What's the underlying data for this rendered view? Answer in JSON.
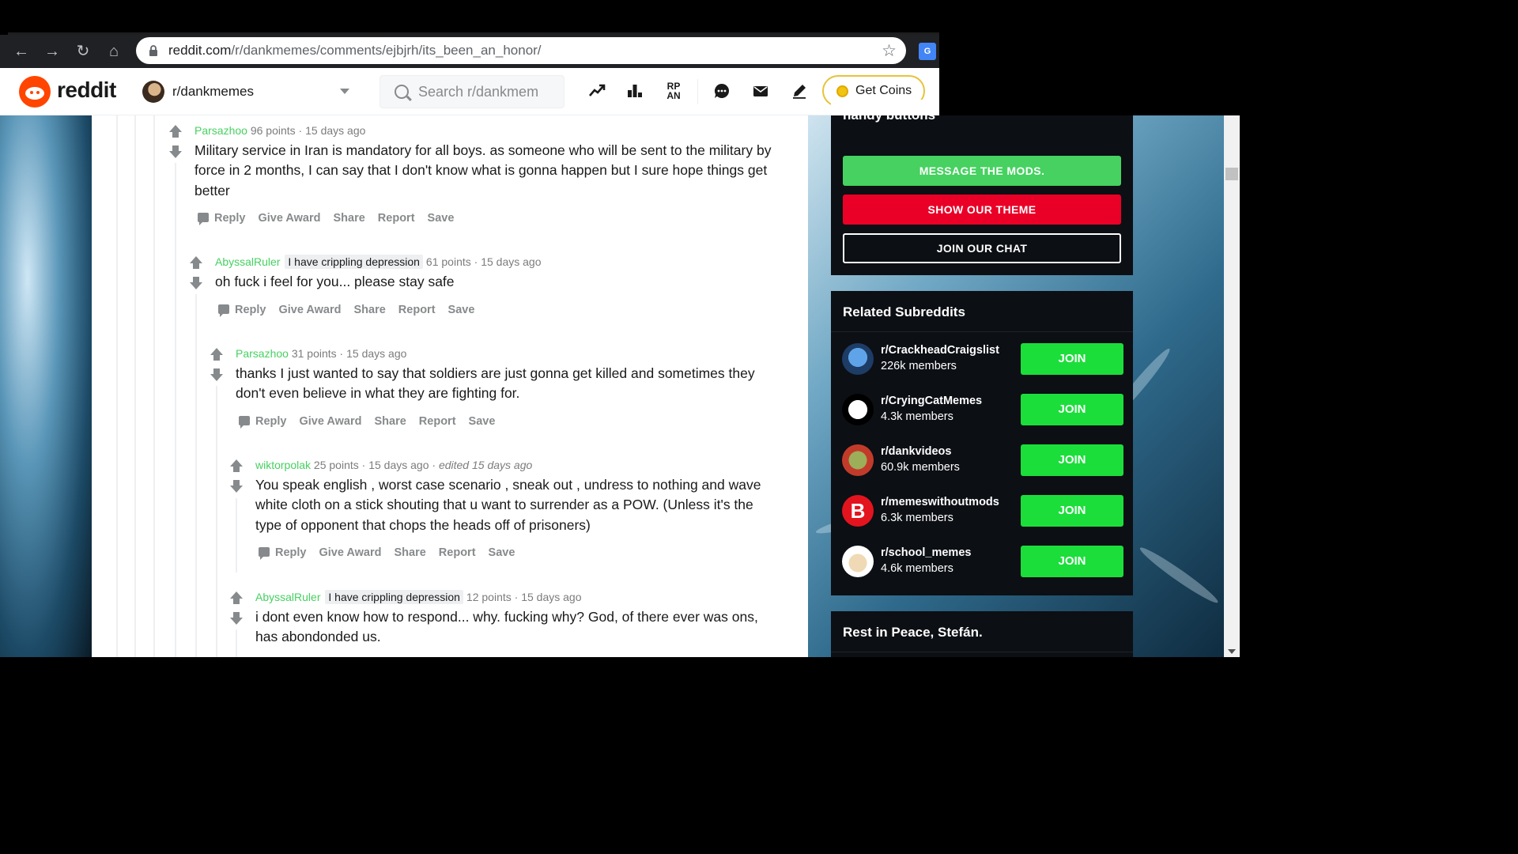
{
  "browser": {
    "url_domain": "reddit.com",
    "url_path": "/r/dankmemes/comments/ejbjrh/its_been_an_honor/",
    "translate_label": "G"
  },
  "header": {
    "logo_text": "reddit",
    "subreddit": "r/dankmemes",
    "search_placeholder": "Search r/dankmem",
    "rpan_label": "RP AN",
    "coins_label": "Get Coins"
  },
  "comments": [
    {
      "author": "Parsazhoo",
      "flair": "",
      "points": "96 points",
      "age": "15 days ago",
      "edited": "",
      "body": "Military service in Iran is mandatory for all boys. as someone who will be sent to the military by force in 2 months, I can say that I don't know what is gonna happen but I sure hope things get better"
    },
    {
      "author": "AbyssalRuler",
      "flair": "I have crippling depression",
      "points": "61 points",
      "age": "15 days ago",
      "edited": "",
      "body": "oh fuck i feel for you... please stay safe"
    },
    {
      "author": "Parsazhoo",
      "flair": "",
      "points": "31 points",
      "age": "15 days ago",
      "edited": "",
      "body": "thanks I just wanted to say that soldiers are just gonna get killed and sometimes they don't even believe in what they are fighting for."
    },
    {
      "author": "wiktorpolak",
      "flair": "",
      "points": "25 points",
      "age": "15 days ago",
      "edited": "edited 15 days ago",
      "body": "You speak english , worst case scenario , sneak out , undress to nothing and wave white cloth on a stick shouting that u want to surrender as a POW. (Unless it's the type of opponent that chops the heads off of prisoners)"
    },
    {
      "author": "AbyssalRuler",
      "flair": "I have crippling depression",
      "points": "12 points",
      "age": "15 days ago",
      "edited": "",
      "body": "i dont even know how to respond... why. fucking why? God, of there ever was ons, has abondonded us."
    }
  ],
  "actions": {
    "reply": "Reply",
    "award": "Give Award",
    "share": "Share",
    "report": "Report",
    "save": "Save"
  },
  "sidebar": {
    "buttons_title": "handy buttons",
    "buttons": [
      {
        "label": "MESSAGE THE MODS.",
        "color": "#46d160"
      },
      {
        "label": "SHOW OUR THEME",
        "color": "#ea0027"
      },
      {
        "label": "JOIN OUR CHAT",
        "color": "#0c0f14"
      }
    ],
    "related_title": "Related Subreddits",
    "related": [
      {
        "name": "r/CrackheadCraigslist",
        "members": "226k members",
        "join": "JOIN"
      },
      {
        "name": "r/CryingCatMemes",
        "members": "4.3k members",
        "join": "JOIN"
      },
      {
        "name": "r/dankvideos",
        "members": "60.9k members",
        "join": "JOIN"
      },
      {
        "name": "r/memeswithoutmods",
        "members": "6.3k members",
        "join": "JOIN"
      },
      {
        "name": "r/school_memes",
        "members": "4.6k members",
        "join": "JOIN"
      }
    ],
    "memorial_title": "Rest in Peace, Stefán."
  },
  "colors": {
    "accent_green": "#46d160",
    "join_green": "#1bde3b",
    "theme_red": "#ea0027",
    "reddit_orange": "#ff4500"
  }
}
